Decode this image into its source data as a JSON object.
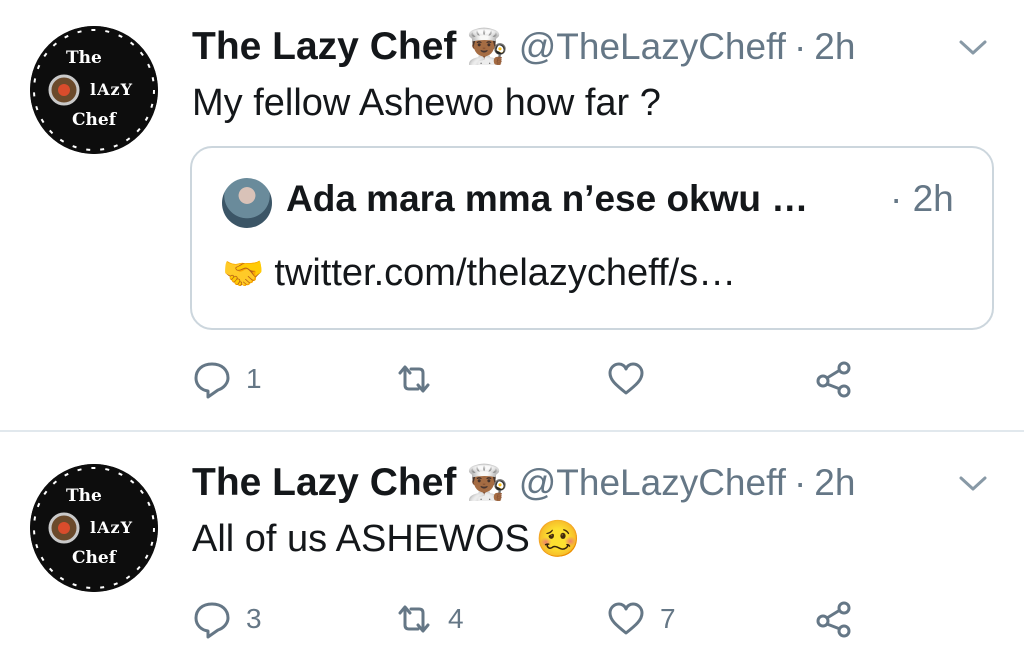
{
  "tweets": [
    {
      "avatar_text": [
        "The",
        "lAzY",
        "Chef"
      ],
      "name": "The Lazy Chef",
      "badge_emoji": "👨🏾‍🍳",
      "handle": "@TheLazyCheff",
      "dot": "·",
      "time": "2h",
      "text": "My fellow Ashewo how far ?",
      "quote": {
        "name": "Ada mara mma n’ese okwu …",
        "time": "· 2h",
        "emoji": "🤝",
        "link_text": "twitter.com/thelazycheff/s…"
      },
      "counts": {
        "reply": "1",
        "retweet": "",
        "like": ""
      }
    },
    {
      "avatar_text": [
        "The",
        "lAzY",
        "Chef"
      ],
      "name": "The Lazy Chef",
      "badge_emoji": "👨🏾‍🍳",
      "handle": "@TheLazyCheff",
      "dot": "·",
      "time": "2h",
      "text": "All of us ASHEWOS",
      "text_emoji": "🥴",
      "counts": {
        "reply": "3",
        "retweet": "4",
        "like": "7"
      }
    }
  ],
  "colors": {
    "text": "#14171a",
    "secondary": "#657786",
    "border": "#ccd6dd",
    "divider": "#e1e8ed"
  },
  "icons": [
    "reply-icon",
    "retweet-icon",
    "like-icon",
    "share-icon",
    "chevron-down-icon"
  ]
}
